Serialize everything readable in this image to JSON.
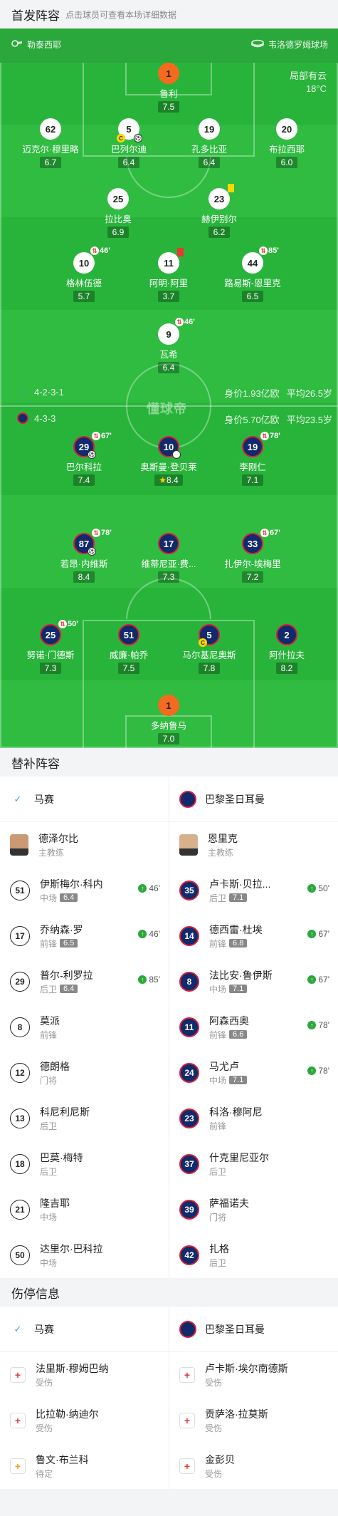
{
  "lineup": {
    "title": "首发阵容",
    "subtitle": "点击球员可查看本场详细数据"
  },
  "match": {
    "referee": "勒泰西耶",
    "venue": "韦洛德罗姆球场",
    "weather_line1": "局部有云",
    "weather_line2": "18°C",
    "watermark": "懂球帝"
  },
  "home_team": {
    "formation": "4-2-3-1",
    "value": "身价1.93亿欧",
    "avg_age": "平均26.5岁"
  },
  "away_team": {
    "formation": "4-3-3",
    "value": "身价5.70亿欧",
    "avg_age": "平均23.5岁"
  },
  "home_players": [
    {
      "number": "1",
      "name": "鲁利",
      "rating": "7.5",
      "gk": true
    },
    {
      "number": "62",
      "name": "迈克尔·穆里略",
      "rating": "6.7"
    },
    {
      "number": "5",
      "name": "巴列尔迪",
      "rating": "6.4",
      "captain": "C"
    },
    {
      "number": "19",
      "name": "孔多比亚",
      "rating": "6.4"
    },
    {
      "number": "20",
      "name": "布拉西耶",
      "rating": "6.0"
    },
    {
      "number": "25",
      "name": "拉比奥",
      "rating": "6.9"
    },
    {
      "number": "23",
      "name": "赫伊别尔",
      "rating": "6.2"
    },
    {
      "number": "10",
      "name": "格林伍德",
      "rating": "5.7",
      "sub": "46'"
    },
    {
      "number": "11",
      "name": "阿明·阿里",
      "rating": "3.7"
    },
    {
      "number": "44",
      "name": "路易斯-恩里克",
      "rating": "6.5",
      "sub": "85'"
    },
    {
      "number": "9",
      "name": "瓦希",
      "rating": "6.4",
      "sub": "46'"
    }
  ],
  "away_players": [
    {
      "number": "29",
      "name": "巴尔科拉",
      "rating": "7.4",
      "sub": "67'"
    },
    {
      "number": "10",
      "name": "奥斯曼·登贝莱",
      "rating": "8.4",
      "star": "★"
    },
    {
      "number": "19",
      "name": "李刚仁",
      "rating": "7.1",
      "sub": "78'"
    },
    {
      "number": "87",
      "name": "若昂·内维斯",
      "rating": "8.4",
      "sub": "78'"
    },
    {
      "number": "17",
      "name": "维蒂尼亚·费...",
      "rating": "7.3"
    },
    {
      "number": "33",
      "name": "扎伊尔-埃梅里",
      "rating": "7.2",
      "sub": "67'"
    },
    {
      "number": "25",
      "name": "努诺·门德斯",
      "rating": "7.3",
      "sub": "50'"
    },
    {
      "number": "51",
      "name": "威廉·帕乔",
      "rating": "7.5"
    },
    {
      "number": "5",
      "name": "马尔基尼奥斯",
      "rating": "7.8",
      "captain": "C"
    },
    {
      "number": "2",
      "name": "阿什拉夫",
      "rating": "8.2"
    },
    {
      "number": "1",
      "name": "多纳鲁马",
      "rating": "7.0",
      "gk": true
    }
  ],
  "subs_section": {
    "title": "替补阵容",
    "home_name": "马赛",
    "away_name": "巴黎圣日耳曼",
    "home_coach": {
      "name": "德泽尔比",
      "role": "主教练"
    },
    "away_coach": {
      "name": "恩里克",
      "role": "主教练"
    },
    "home_subs": [
      {
        "number": "51",
        "name": "伊斯梅尔·科内",
        "pos": "中场",
        "rating": "6.4",
        "minute": "46'"
      },
      {
        "number": "17",
        "name": "乔纳森·罗",
        "pos": "前锋",
        "rating": "6.5",
        "minute": "46'"
      },
      {
        "number": "29",
        "name": "普尔-利罗拉",
        "pos": "后卫",
        "rating": "6.4",
        "minute": "85'"
      },
      {
        "number": "8",
        "name": "莫派",
        "pos": "前锋"
      },
      {
        "number": "12",
        "name": "德朗格",
        "pos": "门将"
      },
      {
        "number": "13",
        "name": "科尼利尼斯",
        "pos": "后卫"
      },
      {
        "number": "18",
        "name": "巴莫·梅特",
        "pos": "后卫"
      },
      {
        "number": "21",
        "name": "隆吉耶",
        "pos": "中场"
      },
      {
        "number": "50",
        "name": "达里尔·巴科拉",
        "pos": "中场"
      }
    ],
    "away_subs": [
      {
        "number": "35",
        "name": "卢卡斯·贝拉...",
        "pos": "后卫",
        "rating": "7.1",
        "minute": "50'"
      },
      {
        "number": "14",
        "name": "德西雷·杜埃",
        "pos": "前锋",
        "rating": "6.8",
        "minute": "67'"
      },
      {
        "number": "8",
        "name": "法比安·鲁伊斯",
        "pos": "中场",
        "rating": "7.1",
        "minute": "67'"
      },
      {
        "number": "11",
        "name": "阿森西奥",
        "pos": "前锋",
        "rating": "6.6",
        "minute": "78'"
      },
      {
        "number": "24",
        "name": "马尤卢",
        "pos": "中场",
        "rating": "7.1",
        "minute": "78'"
      },
      {
        "number": "23",
        "name": "科洛·穆阿尼",
        "pos": "前锋"
      },
      {
        "number": "37",
        "name": "什克里尼亚尔",
        "pos": "后卫"
      },
      {
        "number": "39",
        "name": "萨福诺夫",
        "pos": "门将"
      },
      {
        "number": "42",
        "name": "扎格",
        "pos": "后卫"
      }
    ]
  },
  "injury_section": {
    "title": "伤停信息",
    "home_name": "马赛",
    "away_name": "巴黎圣日耳曼",
    "home": [
      {
        "name": "法里斯·穆姆巴纳",
        "status": "受伤",
        "type": "injured"
      },
      {
        "name": "比拉勒·纳迪尔",
        "status": "受伤",
        "type": "injured"
      },
      {
        "name": "鲁文·布兰科",
        "status": "待定",
        "type": "doubt"
      }
    ],
    "away": [
      {
        "name": "卢卡斯·埃尔南德斯",
        "status": "受伤",
        "type": "injured"
      },
      {
        "name": "贡萨洛·拉莫斯",
        "status": "受伤",
        "type": "injured"
      },
      {
        "name": "金彭贝",
        "status": "受伤",
        "type": "injured"
      }
    ]
  }
}
